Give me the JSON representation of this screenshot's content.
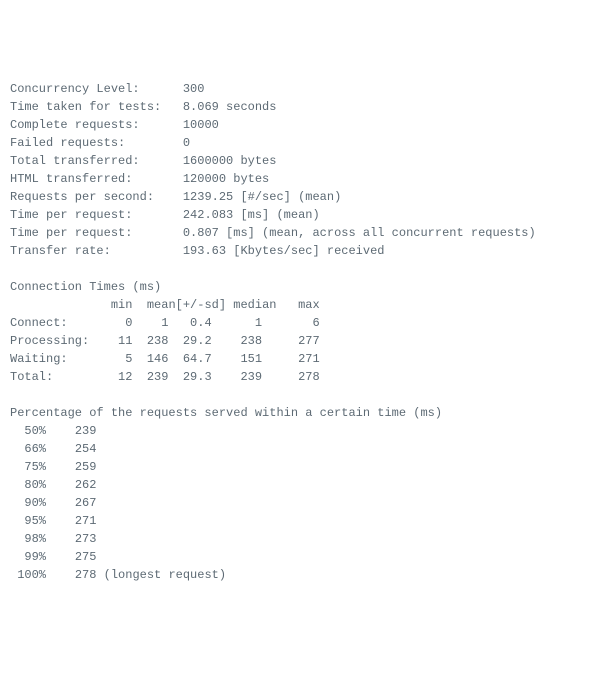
{
  "summary": {
    "concurrency_level_label": "Concurrency Level:",
    "concurrency_level_value": "300",
    "time_taken_label": "Time taken for tests:",
    "time_taken_value": "8.069 seconds",
    "complete_requests_label": "Complete requests:",
    "complete_requests_value": "10000",
    "failed_requests_label": "Failed requests:",
    "failed_requests_value": "0",
    "total_transferred_label": "Total transferred:",
    "total_transferred_value": "1600000 bytes",
    "html_transferred_label": "HTML transferred:",
    "html_transferred_value": "120000 bytes",
    "req_per_sec_label": "Requests per second:",
    "req_per_sec_value": "1239.25 [#/sec] (mean)",
    "time_per_req1_label": "Time per request:",
    "time_per_req1_value": "242.083 [ms] (mean)",
    "time_per_req2_label": "Time per request:",
    "time_per_req2_value": "0.807 [ms] (mean, across all concurrent requests)",
    "transfer_rate_label": "Transfer rate:",
    "transfer_rate_value": "193.63 [Kbytes/sec] received"
  },
  "conn_times": {
    "title": "Connection Times (ms)",
    "header_min": "min",
    "header_mean": "mean",
    "header_sd": "[+/-sd]",
    "header_median": "median",
    "header_max": "max",
    "connect_label": "Connect:",
    "connect_min": "0",
    "connect_mean": "1",
    "connect_sd": "0.4",
    "connect_median": "1",
    "connect_max": "6",
    "processing_label": "Processing:",
    "processing_min": "11",
    "processing_mean": "238",
    "processing_sd": "29.2",
    "processing_median": "238",
    "processing_max": "277",
    "waiting_label": "Waiting:",
    "waiting_min": "5",
    "waiting_mean": "146",
    "waiting_sd": "64.7",
    "waiting_median": "151",
    "waiting_max": "271",
    "total_label": "Total:",
    "total_min": "12",
    "total_mean": "239",
    "total_sd": "29.3",
    "total_median": "239",
    "total_max": "278"
  },
  "percentiles": {
    "title": "Percentage of the requests served within a certain time (ms)",
    "p50_label": "50%",
    "p50_value": "239",
    "p66_label": "66%",
    "p66_value": "254",
    "p75_label": "75%",
    "p75_value": "259",
    "p80_label": "80%",
    "p80_value": "262",
    "p90_label": "90%",
    "p90_value": "267",
    "p95_label": "95%",
    "p95_value": "271",
    "p98_label": "98%",
    "p98_value": "273",
    "p99_label": "99%",
    "p99_value": "275",
    "p100_label": "100%",
    "p100_value": "278",
    "p100_note": "(longest request)"
  }
}
